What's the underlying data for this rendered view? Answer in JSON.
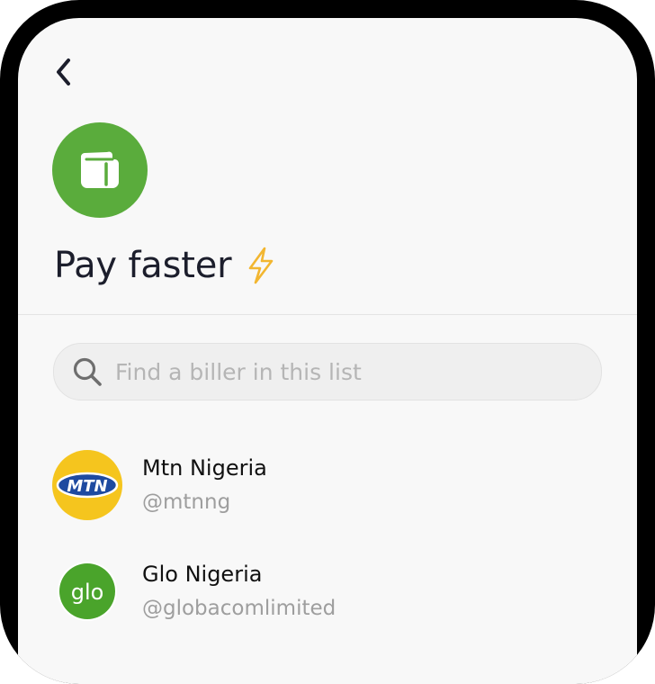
{
  "header": {
    "back_icon": "chevron-left-icon",
    "app_icon": "wallet-icon",
    "app_icon_color": "#5aac3c",
    "title": "Pay faster",
    "title_icon": "lightning-bolt-icon",
    "title_icon_color": "#f2b630"
  },
  "search": {
    "icon": "search-icon",
    "placeholder": "Find a biller in this list",
    "value": ""
  },
  "billers": [
    {
      "name": "Mtn Nigeria",
      "handle": "@mtnng",
      "logo_text": "MTN",
      "logo_bg": "#f5c51e",
      "logo_accent": "#1e4aa0"
    },
    {
      "name": "Glo Nigeria",
      "handle": "@globacomlimited",
      "logo_text": "glo",
      "logo_bg": "#4aa42b"
    }
  ]
}
